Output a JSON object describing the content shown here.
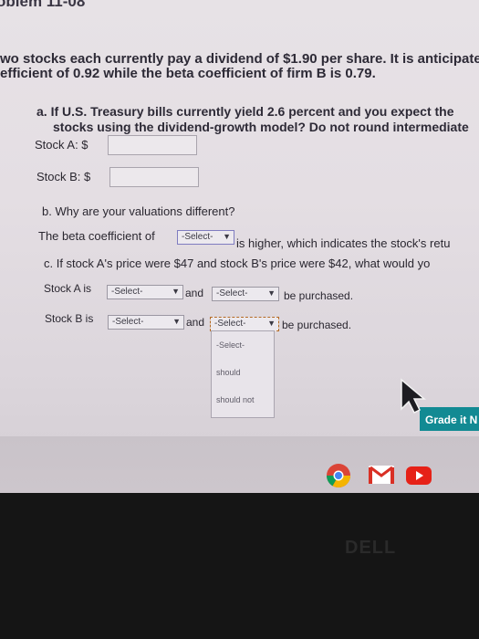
{
  "header": {
    "title": "oblem 11-08"
  },
  "intro": {
    "line1": "wo stocks each currently pay a dividend of $1.90 per share. It is anticipated",
    "line2": "efficient of 0.92 while the beta coefficient of firm B is 0.79."
  },
  "question_a": {
    "line1": "a. If U.S. Treasury bills currently yield 2.6 percent and you expect the",
    "line2": "stocks using the dividend-growth model? Do not round intermediate",
    "stock_a_label": "Stock A: $",
    "stock_a_value": "",
    "stock_b_label": "Stock B: $",
    "stock_b_value": ""
  },
  "question_b": {
    "text": "b. Why are your valuations different?",
    "sentence_prefix": "The beta coefficient of",
    "select_value": "-Select-",
    "sentence_suffix": "is higher, which indicates the stock's retu"
  },
  "question_c": {
    "text": "c. If stock A's price were $47 and stock B's price were $42, what would yo",
    "stock_a_prefix": "Stock A is",
    "stock_a_select1": "-Select-",
    "and_label": "and",
    "stock_a_select2": "-Select-",
    "suffix": "be purchased.",
    "stock_b_prefix": "Stock B is",
    "stock_b_select1": "-Select-",
    "stock_b_select2": "-Select-"
  },
  "dropdown_open": {
    "options": [
      "-Select-",
      "should",
      "should not"
    ]
  },
  "grade_button": {
    "label": "Grade it N"
  },
  "taskbar": {
    "icons": [
      "chrome-icon",
      "gmail-icon",
      "youtube-icon"
    ]
  },
  "device": {
    "brand": "DELL"
  },
  "colors": {
    "grade_button": "#128a93",
    "screen_bg": "#e5e0e4",
    "bezel": "#151515"
  }
}
